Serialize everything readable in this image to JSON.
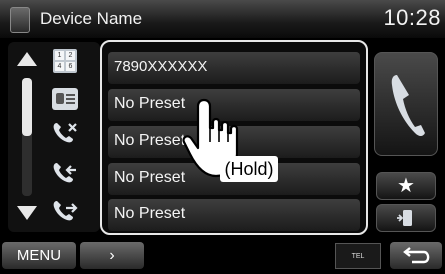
{
  "header": {
    "title": "Device Name",
    "clock": "10:28"
  },
  "sidebar": {
    "keypad_digits": [
      "1",
      "2",
      "4",
      "6"
    ]
  },
  "presets": [
    {
      "label": "7890XXXXXX"
    },
    {
      "label": "No Preset"
    },
    {
      "label": "No Preset"
    },
    {
      "label": "No Preset"
    },
    {
      "label": "No Preset"
    }
  ],
  "right": {
    "preset_star": "★"
  },
  "bottom": {
    "menu_label": "MENU",
    "next_glyph": "›",
    "status_text": "TEL"
  },
  "callout": {
    "hold_label": "(Hold)"
  },
  "colors": {
    "accent": "#e8e8e8",
    "panel_bg": "#0b0b0b"
  },
  "icons": [
    "phone-handset-icon",
    "keypad-icon",
    "phonebook-icon",
    "missed-call-icon",
    "incoming-call-icon",
    "outgoing-call-icon",
    "star-icon",
    "transfer-icon",
    "back-arrow-icon",
    "hand-pointer-icon"
  ]
}
